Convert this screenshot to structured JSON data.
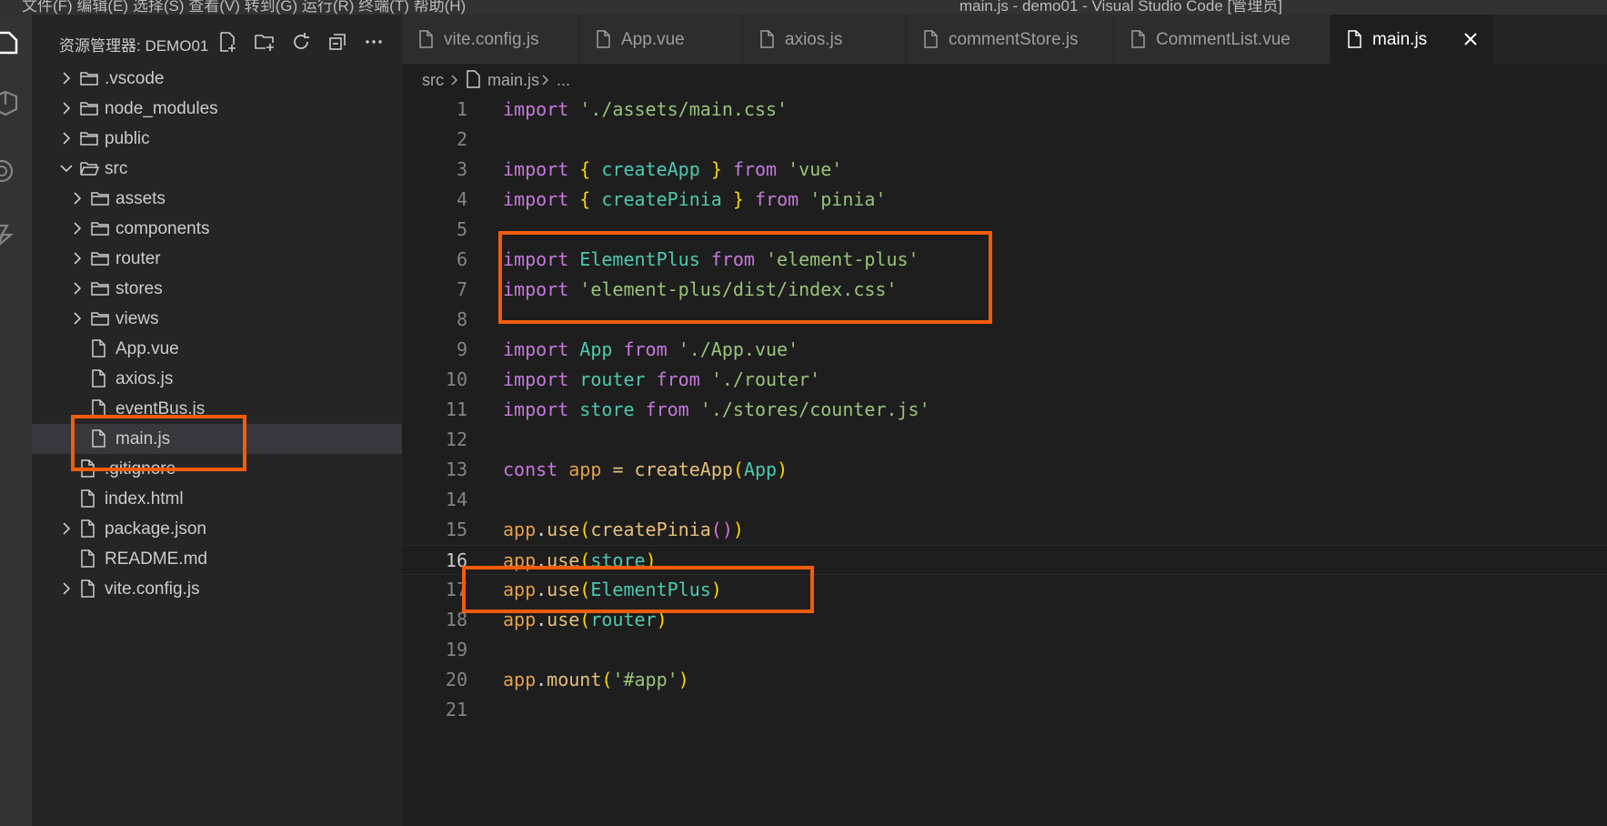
{
  "titlebar": {
    "menu": "文件(F)   编辑(E)   选择(S)   查看(V)   转到(G)   运行(R)   终端(T)   帮助(H)",
    "title": "main.js - demo01 - Visual Studio Code [管理员]"
  },
  "sidebar": {
    "title": "资源管理器: DEMO01",
    "actions": [
      "new-file-icon",
      "new-folder-icon",
      "refresh-icon",
      "collapse-all-icon",
      "more-icon"
    ],
    "tree": [
      {
        "label": ".vscode",
        "type": "folder",
        "depth": 0,
        "expanded": false
      },
      {
        "label": "node_modules",
        "type": "folder",
        "depth": 0,
        "expanded": false
      },
      {
        "label": "public",
        "type": "folder",
        "depth": 0,
        "expanded": false
      },
      {
        "label": "src",
        "type": "folder",
        "depth": 0,
        "expanded": true
      },
      {
        "label": "assets",
        "type": "folder",
        "depth": 1,
        "expanded": false
      },
      {
        "label": "components",
        "type": "folder",
        "depth": 1,
        "expanded": false
      },
      {
        "label": "router",
        "type": "folder",
        "depth": 1,
        "expanded": false
      },
      {
        "label": "stores",
        "type": "folder",
        "depth": 1,
        "expanded": false
      },
      {
        "label": "views",
        "type": "folder",
        "depth": 1,
        "expanded": false
      },
      {
        "label": "App.vue",
        "type": "file",
        "depth": 1
      },
      {
        "label": "axios.js",
        "type": "file",
        "depth": 1
      },
      {
        "label": "eventBus.js",
        "type": "file",
        "depth": 1
      },
      {
        "label": "main.js",
        "type": "file",
        "depth": 1,
        "selected": true
      },
      {
        "label": ".gitignore",
        "type": "file",
        "depth": 0
      },
      {
        "label": "index.html",
        "type": "file",
        "depth": 0
      },
      {
        "label": "package.json",
        "type": "folder-file",
        "depth": 0,
        "expanded": false
      },
      {
        "label": "README.md",
        "type": "file",
        "depth": 0
      },
      {
        "label": "vite.config.js",
        "type": "folder-file",
        "depth": 0,
        "expanded": false
      }
    ]
  },
  "editor": {
    "tabs": [
      {
        "label": "vite.config.js",
        "active": false
      },
      {
        "label": "App.vue",
        "active": false
      },
      {
        "label": "axios.js",
        "active": false
      },
      {
        "label": "commentStore.js",
        "active": false
      },
      {
        "label": "CommentList.vue",
        "active": false
      },
      {
        "label": "main.js",
        "active": true
      }
    ],
    "breadcrumb": [
      "src",
      "main.js",
      "..."
    ],
    "current_line": 16,
    "lines": [
      "import './assets/main.css'",
      "",
      "import { createApp } from 'vue'",
      "import { createPinia } from 'pinia'",
      "",
      "import ElementPlus from 'element-plus'",
      "import 'element-plus/dist/index.css'",
      "",
      "import App from './App.vue'",
      "import router from './router'",
      "import store from './stores/counter.js'",
      "",
      "const app = createApp(App)",
      "",
      "app.use(createPinia())",
      "app.use(store)",
      "app.use(ElementPlus)",
      "app.use(router)",
      "",
      "app.mount('#app')",
      ""
    ]
  },
  "colors": {
    "annotation": "#f25c0a",
    "keyword": "#c678dd",
    "string": "#98c379",
    "identifier": "#4ec9b0",
    "function": "#e5c07b"
  }
}
